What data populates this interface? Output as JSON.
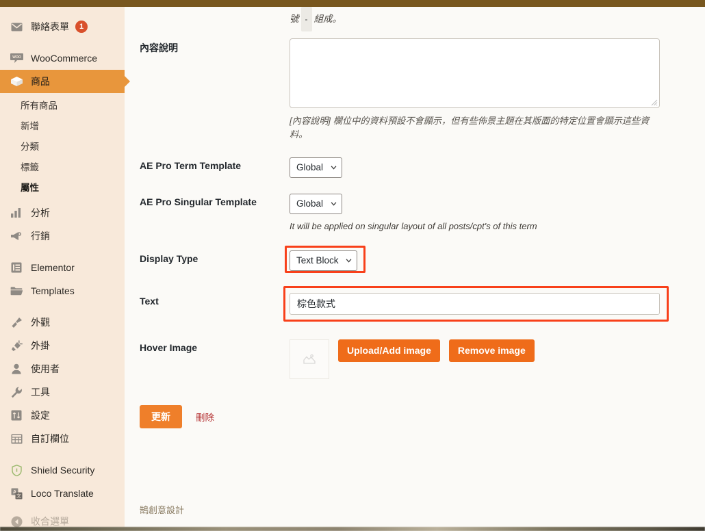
{
  "theme": {
    "adminbar_color": "#78571f",
    "sidebar_bg": "#f8e9da",
    "accent_orange": "#e8963c",
    "button_orange": "#ef6c1a",
    "highlight_red": "#f8401a",
    "content_bg": "#fbfaf7"
  },
  "sidebar": {
    "items": [
      {
        "label": "聯絡表單",
        "icon": "mail-icon",
        "badge": "1",
        "current": false
      },
      {
        "label": "WooCommerce",
        "icon": "woocommerce-icon",
        "badge": "",
        "current": false
      },
      {
        "label": "商品",
        "icon": "product-box-icon",
        "badge": "",
        "current": true
      },
      {
        "label": "分析",
        "icon": "analytics-bars-icon",
        "badge": "",
        "current": false
      },
      {
        "label": "行銷",
        "icon": "megaphone-icon",
        "badge": "",
        "current": false
      },
      {
        "label": "Elementor",
        "icon": "elementor-icon",
        "badge": "",
        "current": false
      },
      {
        "label": "Templates",
        "icon": "folder-icon",
        "badge": "",
        "current": false
      },
      {
        "label": "外觀",
        "icon": "paintbrush-icon",
        "badge": "",
        "current": false
      },
      {
        "label": "外掛",
        "icon": "plug-icon",
        "badge": "",
        "current": false
      },
      {
        "label": "使用者",
        "icon": "user-icon",
        "badge": "",
        "current": false
      },
      {
        "label": "工具",
        "icon": "wrench-icon",
        "badge": "",
        "current": false
      },
      {
        "label": "設定",
        "icon": "settings-sliders-icon",
        "badge": "",
        "current": false
      },
      {
        "label": "自訂欄位",
        "icon": "custom-fields-icon",
        "badge": "",
        "current": false
      },
      {
        "label": "Shield Security",
        "icon": "shield-icon",
        "badge": "",
        "current": false
      },
      {
        "label": "Loco Translate",
        "icon": "translate-icon",
        "badge": "",
        "current": false
      },
      {
        "label": "收合選單",
        "icon": "collapse-arrow-icon",
        "badge": "",
        "current": false
      }
    ],
    "product_submenu": [
      {
        "label": "所有商品",
        "active": false
      },
      {
        "label": "新增",
        "active": false
      },
      {
        "label": "分類",
        "active": false
      },
      {
        "label": "標籤",
        "active": false
      },
      {
        "label": "屬性",
        "active": true
      }
    ]
  },
  "form": {
    "clipped_top_text": "號",
    "clipped_kbd": "-",
    "clipped_top_text2": "組成。",
    "description": {
      "label": "內容說明",
      "value": "",
      "placeholder": "",
      "help": "[內容說明] 欄位中的資料預設不會顯示，但有些佈景主題在其版面的特定位置會顯示這些資料。"
    },
    "term_template": {
      "label": "AE Pro Term Template",
      "value": "Global",
      "options": [
        "Global"
      ]
    },
    "singular_template": {
      "label": "AE Pro Singular Template",
      "value": "Global",
      "options": [
        "Global"
      ],
      "help": "It will be applied on singular layout of all posts/cpt's of this term"
    },
    "display_type": {
      "label": "Display Type",
      "value": "Text Block",
      "options": [
        "Text Block"
      ],
      "highlighted": true
    },
    "text_field": {
      "label": "Text",
      "value": "棕色款式",
      "placeholder": "",
      "highlighted": true
    },
    "hover_image": {
      "label": "Hover Image",
      "placeholder_icon": "broken-image-icon",
      "upload_button": "Upload/Add image",
      "remove_button": "Remove image"
    },
    "actions": {
      "update_button": "更新",
      "delete_link": "刪除"
    }
  },
  "footer": {
    "credit": "鵠創意設計"
  }
}
